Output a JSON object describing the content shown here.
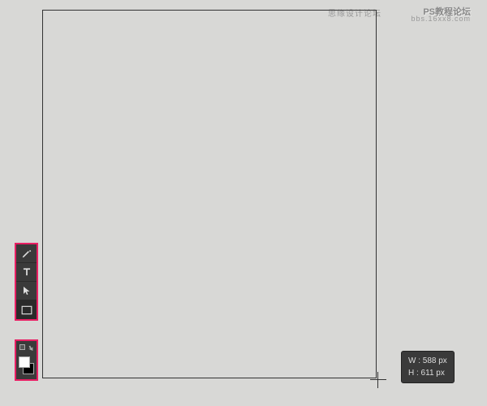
{
  "watermark": {
    "left_text": "思缘设计论坛",
    "right_text": "PS教程论坛",
    "sub_text": "bbs.16xx8.com"
  },
  "dimensions": {
    "width_label": "W :  588 px",
    "height_label": "H :  611 px"
  },
  "tools": {
    "pen": "pen-tool",
    "type": "type-tool",
    "path_select": "path-selection-tool",
    "rectangle": "rectangle-tool"
  },
  "colors": {
    "foreground": "#ffffff",
    "background": "#000000",
    "highlight": "#e91e63"
  }
}
